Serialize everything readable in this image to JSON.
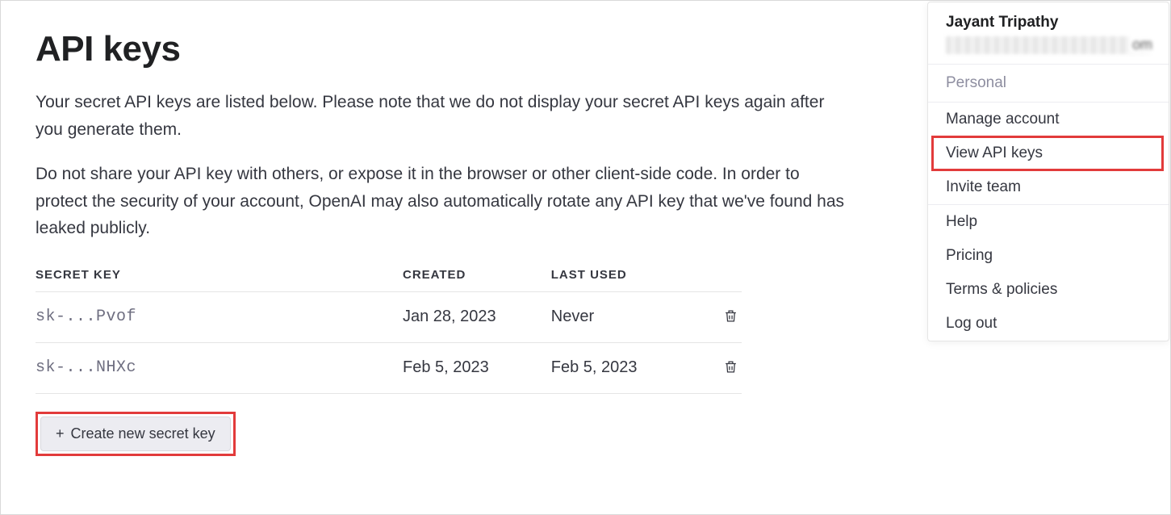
{
  "page": {
    "title": "API keys",
    "description1": "Your secret API keys are listed below. Please note that we do not display your secret API keys again after you generate them.",
    "description2": "Do not share your API key with others, or expose it in the browser or other client-side code. In order to protect the security of your account, OpenAI may also automatically rotate any API key that we've found has leaked publicly."
  },
  "table": {
    "headers": {
      "secret": "SECRET KEY",
      "created": "CREATED",
      "lastused": "LAST USED"
    },
    "rows": [
      {
        "secret": "sk-...Pvof",
        "created": "Jan 28, 2023",
        "lastused": "Never"
      },
      {
        "secret": "sk-...NHXc",
        "created": "Feb 5, 2023",
        "lastused": "Feb 5, 2023"
      }
    ]
  },
  "buttons": {
    "create": "Create new secret key"
  },
  "menu": {
    "username": "Jayant Tripathy",
    "section_label": "Personal",
    "items": {
      "manage": "Manage account",
      "view_keys": "View API keys",
      "invite": "Invite team",
      "help": "Help",
      "pricing": "Pricing",
      "terms": "Terms & policies",
      "logout": "Log out"
    }
  }
}
